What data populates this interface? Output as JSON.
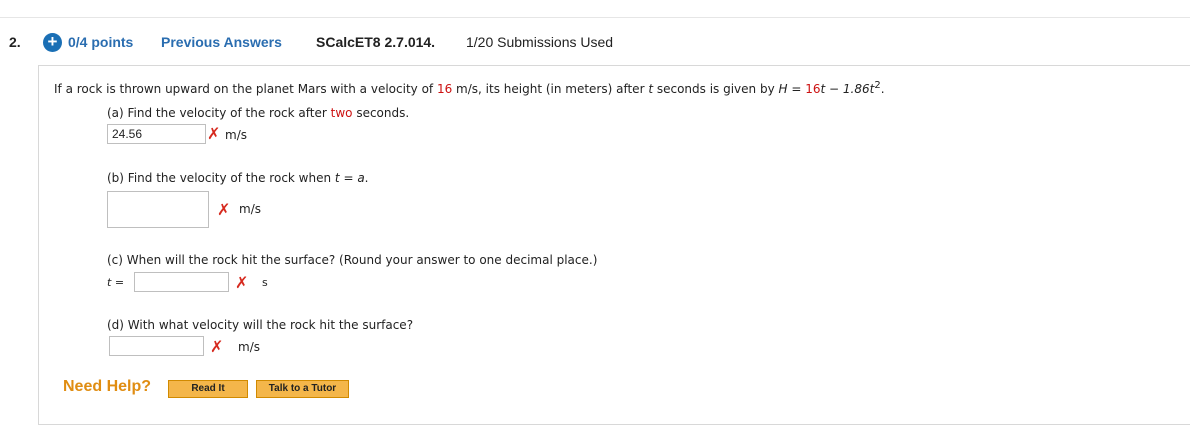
{
  "header": {
    "question_number": "2.",
    "points": "0/4 points",
    "previous_answers": "Previous Answers",
    "question_id": "SCalcET8 2.7.014.",
    "submissions": "1/20 Submissions Used"
  },
  "question": {
    "prompt_part1": "If a rock is thrown upward on the planet Mars with a velocity of ",
    "velocity_value": "16",
    "prompt_part2": " m/s, its height (in meters) after ",
    "var_t": "t",
    "prompt_part3": " seconds is given by ",
    "var_H": "H",
    "prompt_part4": " = ",
    "coef": "16",
    "formula_rest": "t − 1.86t",
    "exponent": "2",
    "prompt_end": "."
  },
  "parts": {
    "a": {
      "text_before": "(a) Find the velocity of the rock after ",
      "highlight": "two",
      "text_after": " seconds.",
      "answer": "24.56",
      "unit": "m/s"
    },
    "b": {
      "text": "(b) Find the velocity of the rock when ",
      "var": "t",
      "text_mid": " = ",
      "var2": "a",
      "text_end": ".",
      "answer": "",
      "unit": "m/s"
    },
    "c": {
      "text": "(c) When will the rock hit the surface? (Round your answer to one decimal place.)",
      "label_t": "t",
      "label_eq": " =",
      "answer": "",
      "unit": "s"
    },
    "d": {
      "text": "(d) With what velocity will the rock hit the surface?",
      "answer": "",
      "unit": "m/s"
    }
  },
  "help": {
    "label": "Need Help?",
    "read_it": "Read It",
    "talk_tutor": "Talk to a Tutor"
  },
  "colors": {
    "link_blue": "#2a6db0",
    "error_red": "#d62a1f",
    "help_orange": "#e08d12",
    "button_orange": "#f4b64a"
  }
}
